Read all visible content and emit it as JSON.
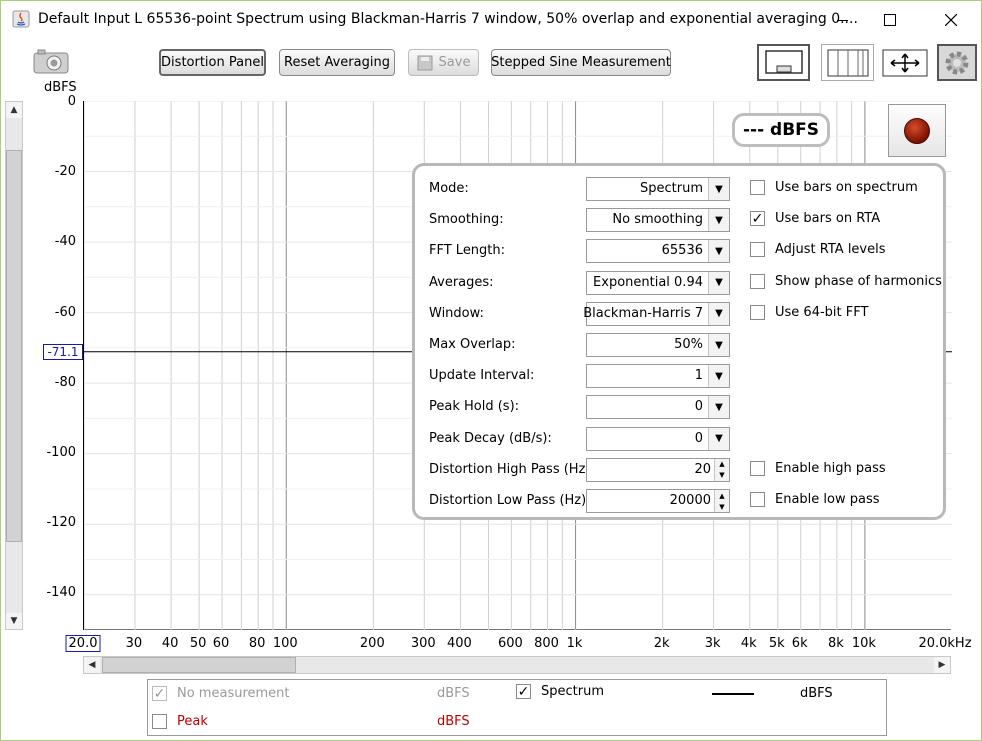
{
  "window": {
    "title": "Default Input L 65536-point Spectrum using Blackman-Harris 7 window, 50% overlap and exponential averaging 0...."
  },
  "toolbar": {
    "distortion_panel": "Distortion Panel",
    "reset_averaging": "Reset Averaging",
    "save": "Save",
    "stepped_sine": "Stepped Sine Measurement"
  },
  "y_axis": {
    "unit": "dBFS",
    "ticks": [
      "0",
      "-20",
      "-40",
      "-60",
      "-80",
      "-100",
      "-120",
      "-140"
    ],
    "cursor_value": "-71.1"
  },
  "x_axis": {
    "ticks": [
      "20.0",
      "30",
      "40",
      "50",
      "60",
      "80",
      "100",
      "200",
      "300",
      "400",
      "600",
      "800",
      "1k",
      "2k",
      "3k",
      "4k",
      "5k",
      "6k",
      "8k",
      "10k",
      "20.0kHz"
    ]
  },
  "readout": "--- dBFS",
  "settings": {
    "rows": [
      {
        "label": "Mode:",
        "value": "Spectrum",
        "control": "combo"
      },
      {
        "label": "Smoothing:",
        "value": "No  smoothing",
        "control": "combo"
      },
      {
        "label": "FFT Length:",
        "value": "65536",
        "control": "combo"
      },
      {
        "label": "Averages:",
        "value": "Exponential 0.94",
        "control": "combo"
      },
      {
        "label": "Window:",
        "value": "Blackman-Harris 7",
        "control": "combo"
      },
      {
        "label": "Max Overlap:",
        "value": "50%",
        "control": "combo"
      },
      {
        "label": "Update Interval:",
        "value": "1",
        "control": "combo"
      },
      {
        "label": "Peak Hold (s):",
        "value": "0",
        "control": "combo"
      },
      {
        "label": "Peak Decay (dB/s):",
        "value": "0",
        "control": "combo"
      },
      {
        "label": "Distortion High Pass (Hz):",
        "value": "20",
        "control": "spinner"
      },
      {
        "label": "Distortion Low Pass (Hz):",
        "value": "20000",
        "control": "spinner"
      }
    ],
    "checkboxes": [
      {
        "label": "Use bars on spectrum",
        "checked": false
      },
      {
        "label": "Use bars on RTA",
        "checked": true
      },
      {
        "label": "Adjust RTA levels",
        "checked": false
      },
      {
        "label": "Show phase of harmonics",
        "checked": false
      },
      {
        "label": "Use 64-bit FFT",
        "checked": false
      },
      {
        "label": "Enable high pass",
        "checked": false
      },
      {
        "label": "Enable low pass",
        "checked": false
      }
    ]
  },
  "legend": {
    "no_measurement": "No measurement",
    "no_measurement_unit": "dBFS",
    "peak": "Peak",
    "peak_unit": "dBFS",
    "spectrum": "Spectrum",
    "spectrum_unit": "dBFS"
  },
  "colors": {
    "window_border": "#a9cf7a",
    "peak_text": "#c00000",
    "cursor_box": "#1a1aa8",
    "grid": "#d0d0d0"
  }
}
